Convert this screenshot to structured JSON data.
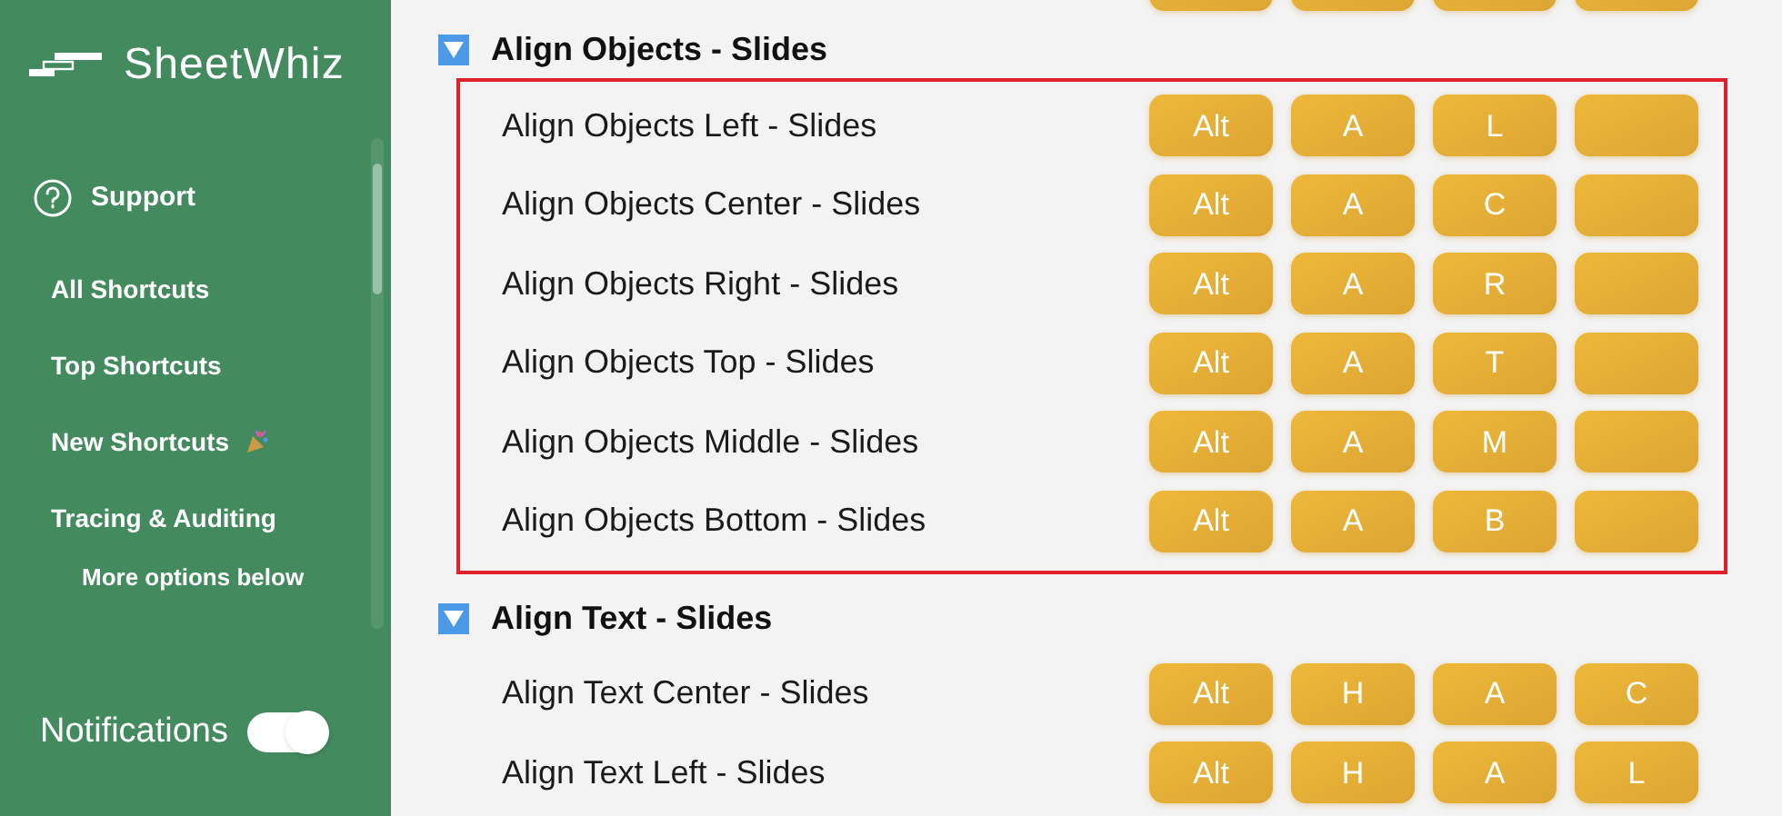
{
  "sidebar": {
    "logo": "SheetWhiz",
    "support": "Support",
    "items": [
      {
        "label": "All Shortcuts",
        "badge": false
      },
      {
        "label": "Top Shortcuts",
        "badge": false
      },
      {
        "label": "New Shortcuts",
        "badge": true
      },
      {
        "label": "Tracing & Auditing",
        "badge": false
      }
    ],
    "more_hint": "More options below",
    "notifications": {
      "label": "Notifications",
      "on": true
    }
  },
  "sections": [
    {
      "title": "Align Objects - Slides",
      "expanded": true,
      "highlighted": true,
      "rows": [
        {
          "label": "Align Objects Left - Slides",
          "keys": [
            "Alt",
            "A",
            "L"
          ]
        },
        {
          "label": "Align Objects Center - Slides",
          "keys": [
            "Alt",
            "A",
            "C"
          ]
        },
        {
          "label": "Align Objects Right - Slides",
          "keys": [
            "Alt",
            "A",
            "R"
          ]
        },
        {
          "label": "Align Objects Top - Slides",
          "keys": [
            "Alt",
            "A",
            "T"
          ]
        },
        {
          "label": "Align Objects Middle - Slides",
          "keys": [
            "Alt",
            "A",
            "M"
          ]
        },
        {
          "label": "Align Objects Bottom - Slides",
          "keys": [
            "Alt",
            "A",
            "B"
          ]
        }
      ]
    },
    {
      "title": "Align Text - Slides",
      "expanded": true,
      "highlighted": false,
      "rows": [
        {
          "label": "Align Text Center - Slides",
          "keys": [
            "Alt",
            "H",
            "A",
            "C"
          ]
        },
        {
          "label": "Align Text Left - Slides",
          "keys": [
            "Alt",
            "H",
            "A",
            "L"
          ]
        }
      ]
    }
  ]
}
